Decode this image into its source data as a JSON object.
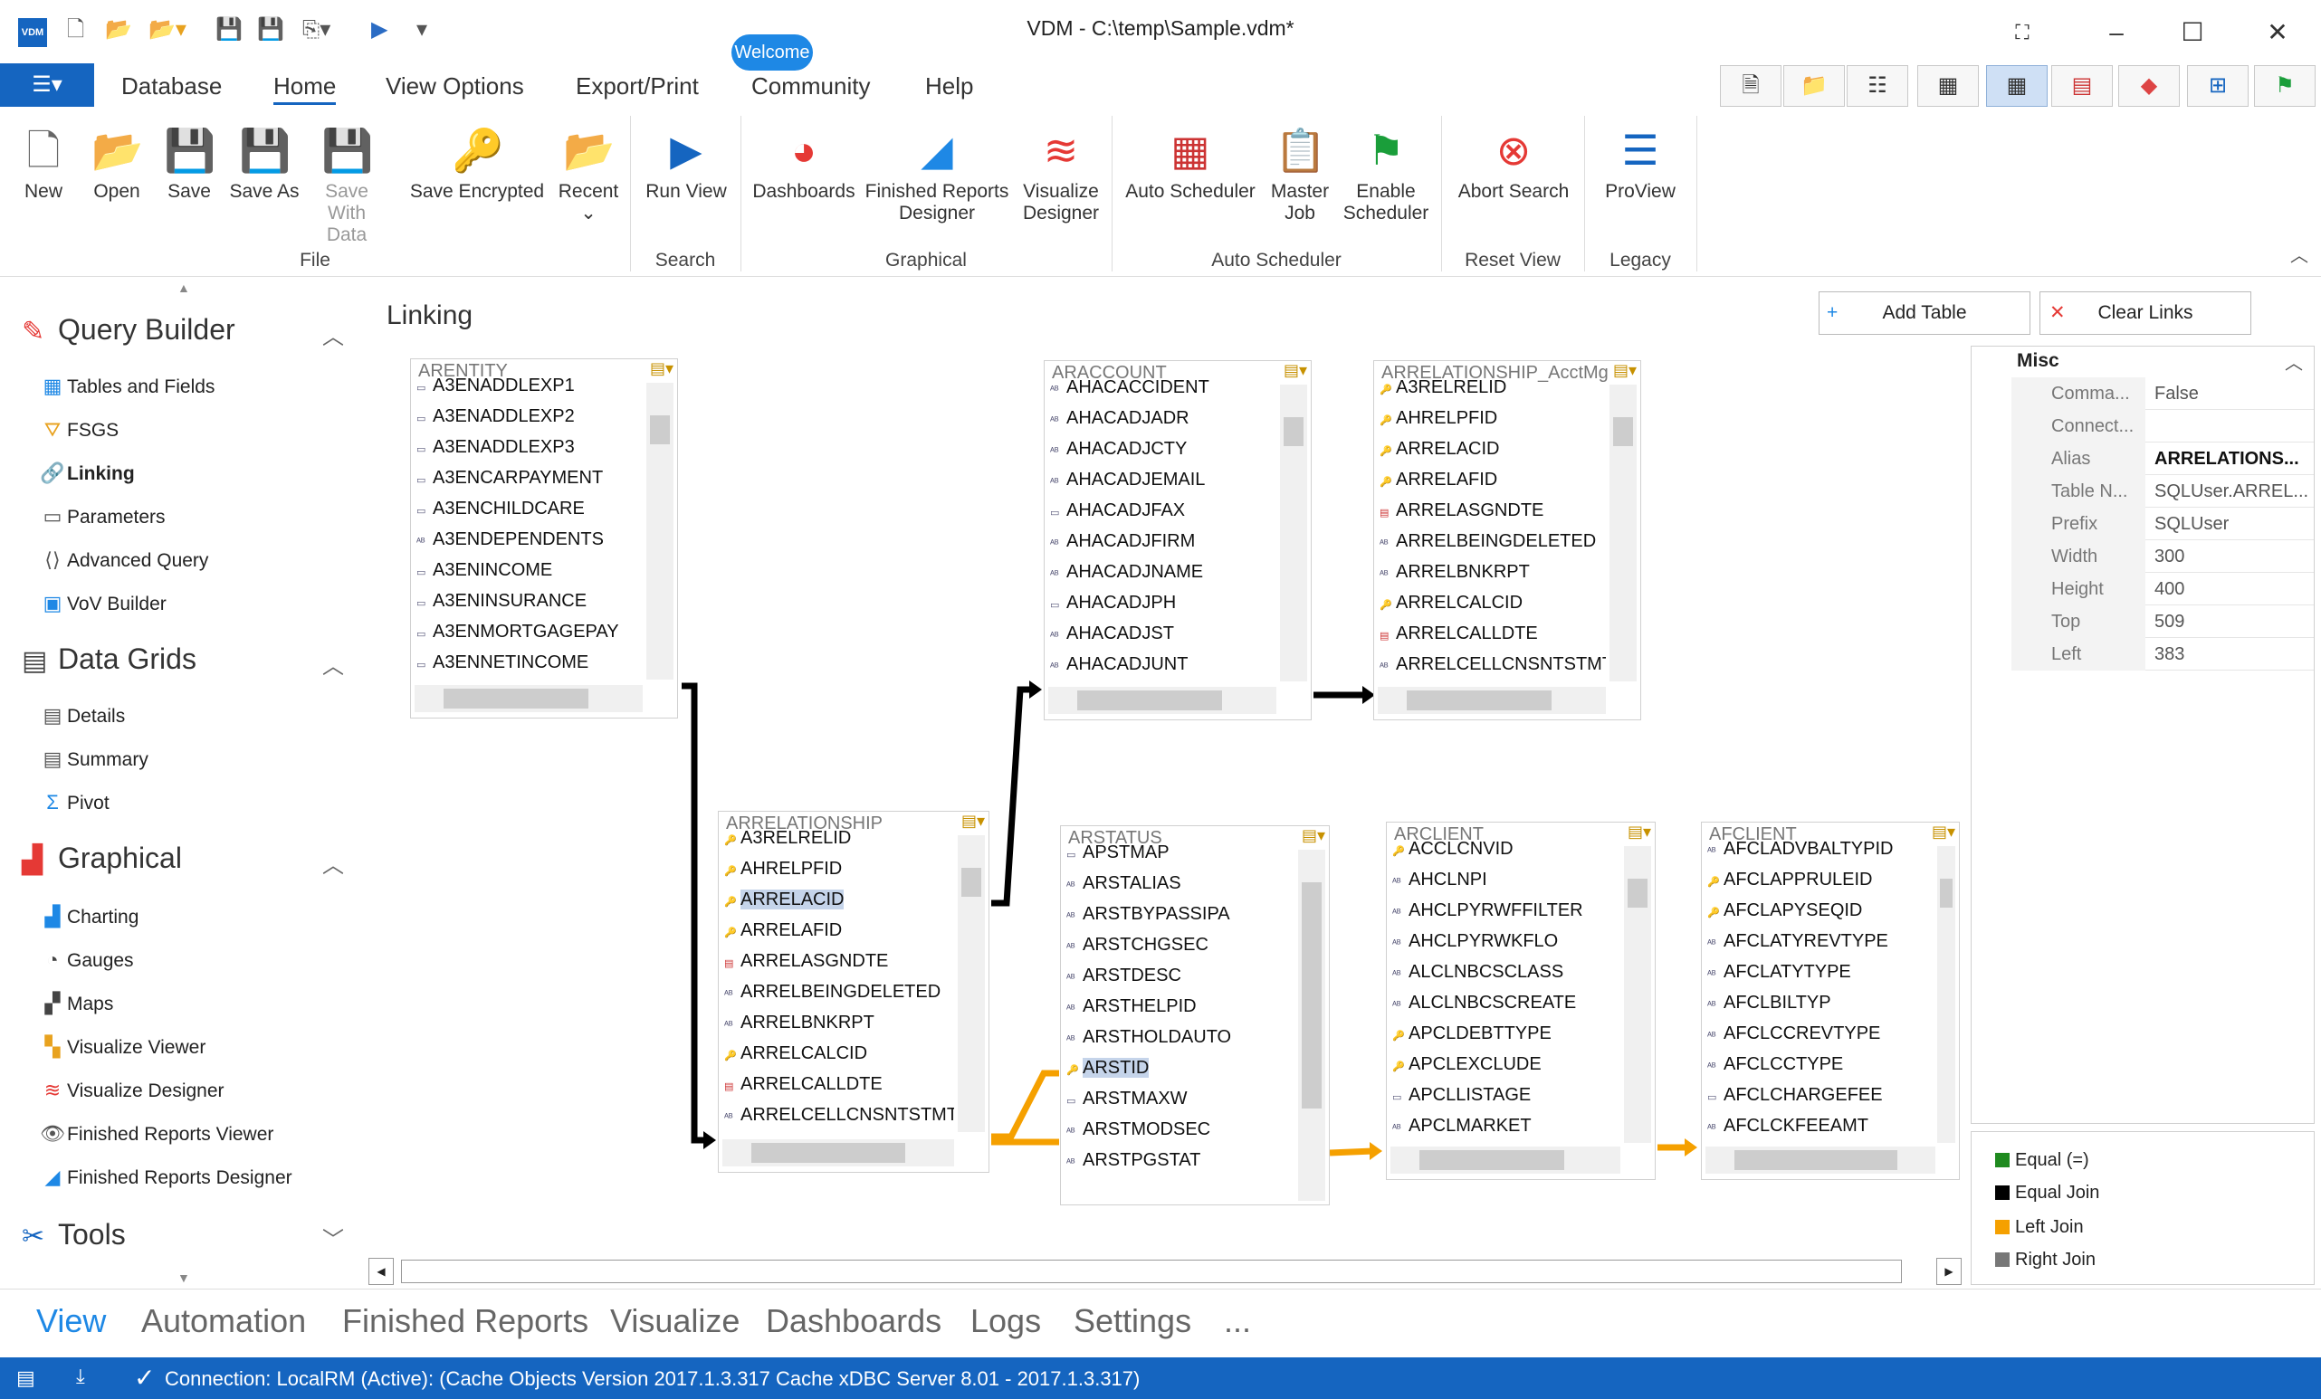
{
  "window": {
    "title": "VDM - C:\\temp\\Sample.vdm*",
    "logo": "VDM"
  },
  "tabs": {
    "file_icon": "menu-icon",
    "items": [
      {
        "label": "Database"
      },
      {
        "label": "Home"
      },
      {
        "label": "View Options"
      },
      {
        "label": "Export/Print"
      },
      {
        "label": "Community"
      },
      {
        "label": "Help"
      }
    ],
    "welcome_badge": "Welcome"
  },
  "ribbon": {
    "buttons": [
      {
        "label": "New",
        "icon": "new-document-icon"
      },
      {
        "label": "Open",
        "icon": "open-folder-icon"
      },
      {
        "label": "Save",
        "icon": "save-icon"
      },
      {
        "label": "Save As",
        "icon": "save-as-icon"
      },
      {
        "label": "Save With Data",
        "icon": "save-with-data-icon"
      },
      {
        "label": "Save Encrypted",
        "icon": "lock-icon"
      },
      {
        "label": "Recent",
        "icon": "recent-folder-icon"
      },
      {
        "label": "Run View",
        "icon": "play-icon"
      },
      {
        "label": "Dashboards",
        "icon": "pie-chart-icon"
      },
      {
        "label": "Finished Reports Designer",
        "icon": "area-chart-icon"
      },
      {
        "label": "Visualize Designer",
        "icon": "visualize-icon"
      },
      {
        "label": "Auto Scheduler",
        "icon": "calendar-icon"
      },
      {
        "label": "Master Job",
        "icon": "clipboard-icon"
      },
      {
        "label": "Enable Scheduler",
        "icon": "flag-icon"
      },
      {
        "label": "Abort Search",
        "icon": "abort-icon"
      },
      {
        "label": "ProView",
        "icon": "proview-icon"
      }
    ],
    "groups": [
      "File",
      "Search",
      "Graphical",
      "Auto Scheduler",
      "Reset View",
      "Legacy"
    ]
  },
  "leftnav": {
    "sections": [
      {
        "title": "Query Builder",
        "items": [
          "Tables and Fields",
          "FSGS",
          "Linking",
          "Parameters",
          "Advanced Query",
          "VoV Builder"
        ]
      },
      {
        "title": "Data Grids",
        "items": [
          "Details",
          "Summary",
          "Pivot"
        ]
      },
      {
        "title": "Graphical",
        "items": [
          "Charting",
          "Gauges",
          "Maps",
          "Visualize Viewer",
          "Visualize Designer",
          "Finished Reports Viewer",
          "Finished Reports Designer"
        ]
      },
      {
        "title": "Tools",
        "items": []
      }
    ]
  },
  "workspace": {
    "title": "Linking",
    "add_table": "Add Table",
    "clear_links": "Clear Links"
  },
  "tables": [
    {
      "name": "ARENTITY",
      "fields": [
        "A3ENADDLEXP1",
        "A3ENADDLEXP2",
        "A3ENADDLEXP3",
        "A3ENCARPAYMENT",
        "A3ENCHILDCARE",
        "A3ENDEPENDENTS",
        "A3ENINCOME",
        "A3ENINSURANCE",
        "A3ENMORTGAGEPAY",
        "A3ENNETINCOME"
      ]
    },
    {
      "name": "ARACCOUNT",
      "fields": [
        "AHACACCIDENT",
        "AHACADJADR",
        "AHACADJCTY",
        "AHACADJEMAIL",
        "AHACADJFAX",
        "AHACADJFIRM",
        "AHACADJNAME",
        "AHACADJPH",
        "AHACADJST",
        "AHACADJUNT"
      ]
    },
    {
      "name": "ARRELATIONSHIP_AcctMg",
      "fields": [
        "A3RELRELID",
        "AHRELPFID",
        "ARRELACID",
        "ARRELAFID",
        "ARRELASGNDTE",
        "ARRELBEINGDELETED",
        "ARRELBNKRPT",
        "ARRELCALCID",
        "ARRELCALLDTE",
        "ARRELCELLCNSNTSTMT"
      ]
    },
    {
      "name": "ARRELATIONSHIP",
      "fields": [
        "A3RELRELID",
        "AHRELPFID",
        "ARRELACID",
        "ARRELAFID",
        "ARRELASGNDTE",
        "ARRELBEINGDELETED",
        "ARRELBNKRPT",
        "ARRELCALCID",
        "ARRELCALLDTE",
        "ARRELCELLCNSNTSTMT"
      ]
    },
    {
      "name": "ARSTATUS",
      "fields": [
        "APSTMAP",
        "ARSTALIAS",
        "ARSTBYPASSIPA",
        "ARSTCHGSEC",
        "ARSTDESC",
        "ARSTHELPID",
        "ARSTHOLDAUTO",
        "ARSTID",
        "ARSTMAXW",
        "ARSTMODSEC",
        "ARSTPGSTAT"
      ]
    },
    {
      "name": "ARCLIENT",
      "fields": [
        "ACCLCNVID",
        "AHCLNPI",
        "AHCLPYRWFFILTER",
        "AHCLPYRWKFLO",
        "ALCLNBCSCLASS",
        "ALCLNBCSCREATE",
        "APCLDEBTTYPE",
        "APCLEXCLUDE",
        "APCLLISTAGE",
        "APCLMARKET"
      ]
    },
    {
      "name": "AFCLIENT",
      "fields": [
        "AFCLADVBALTYPID",
        "AFCLAPPRULEID",
        "AFCLAPYSEQID",
        "AFCLATYREVTYPE",
        "AFCLATYTYPE",
        "AFCLBILTYP",
        "AFCLCCREVTYPE",
        "AFCLCCTYPE",
        "AFCLCHARGEFEE",
        "AFCLCKFEEAMT"
      ]
    }
  ],
  "properties": {
    "category": "Misc",
    "rows": [
      {
        "key": "Comma...",
        "value": "False"
      },
      {
        "key": "Connect...",
        "value": ""
      },
      {
        "key": "Alias",
        "value": "ARRELATIONS..."
      },
      {
        "key": "Table N...",
        "value": "SQLUser.ARREL..."
      },
      {
        "key": "Prefix",
        "value": "SQLUser"
      },
      {
        "key": "Width",
        "value": "300"
      },
      {
        "key": "Height",
        "value": "400"
      },
      {
        "key": "Top",
        "value": "509"
      },
      {
        "key": "Left",
        "value": "383"
      }
    ]
  },
  "legend": [
    {
      "label": "Equal (=)",
      "color": "#1f8a1f"
    },
    {
      "label": "Equal Join",
      "color": "#000000"
    },
    {
      "label": "Left Join",
      "color": "#f5a000"
    },
    {
      "label": "Right Join",
      "color": "#777777"
    }
  ],
  "bottomnav": [
    "View",
    "Automation",
    "Finished Reports",
    "Visualize",
    "Dashboards",
    "Logs",
    "Settings",
    "..."
  ],
  "status": {
    "text": "Connection: LocalRM (Active): (Cache Objects Version 2017.1.3.317 Cache xDBC Server 8.01 - 2017.1.3.317)"
  },
  "colors": {
    "accent": "#1565c0",
    "highlight": "#c5d4ea",
    "equal_join": "#000000",
    "left_join": "#f5a000"
  }
}
